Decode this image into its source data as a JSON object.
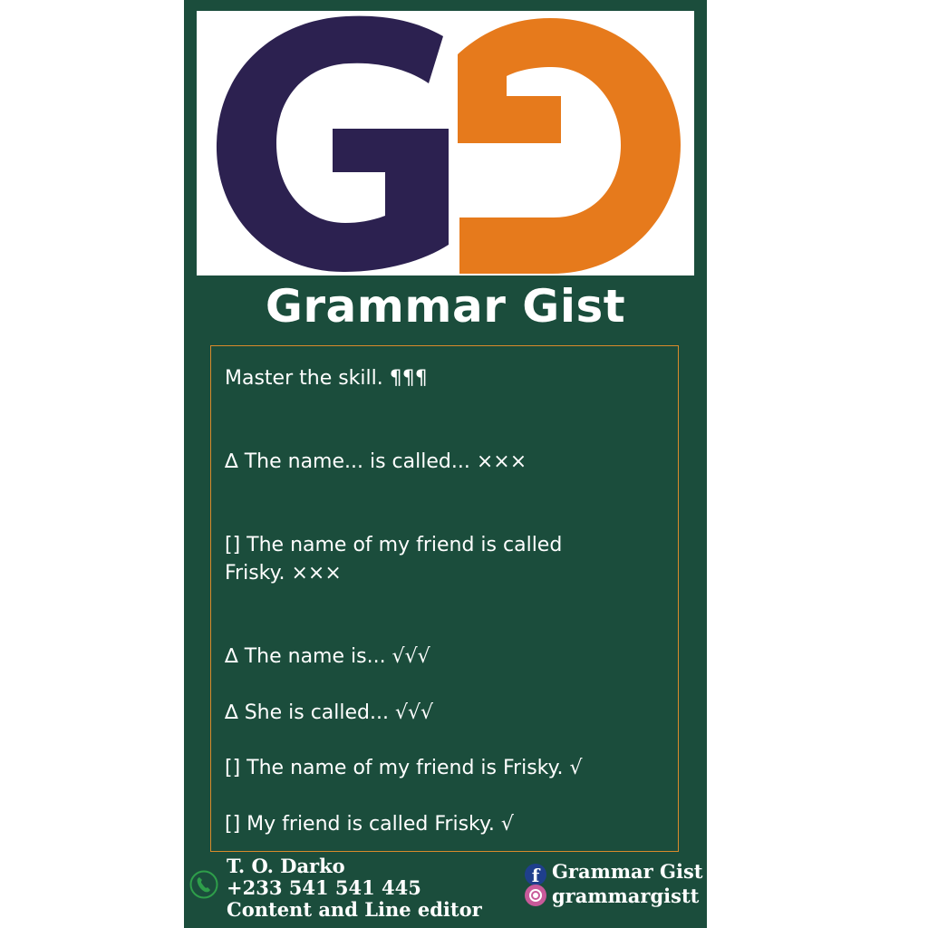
{
  "brand": {
    "logo_letters": "GG",
    "title": "Grammar Gist",
    "colors": {
      "card_bg": "#1b4d3c",
      "logo_purple": "#2c2150",
      "logo_orange": "#e67a1c",
      "border": "#d98a2b"
    }
  },
  "lesson": {
    "lines": [
      "Master the skill. ¶¶¶",
      "∆ The name... is called... ×××",
      "[] The name of my friend is called\nFrisky. ×××",
      "∆ The name is... √√√",
      "∆ She is called... √√√",
      "[] The name of my friend is Frisky. √",
      "[] My friend is called Frisky. √"
    ]
  },
  "footer": {
    "author": "T. O. Darko",
    "phone": "+233 541 541 445",
    "role": "Content and Line editor",
    "phone_icon": "phone-icon",
    "facebook": {
      "icon": "facebook-icon",
      "label": "Grammar Gist"
    },
    "instagram": {
      "icon": "instagram-icon",
      "label": "grammargistt"
    }
  }
}
